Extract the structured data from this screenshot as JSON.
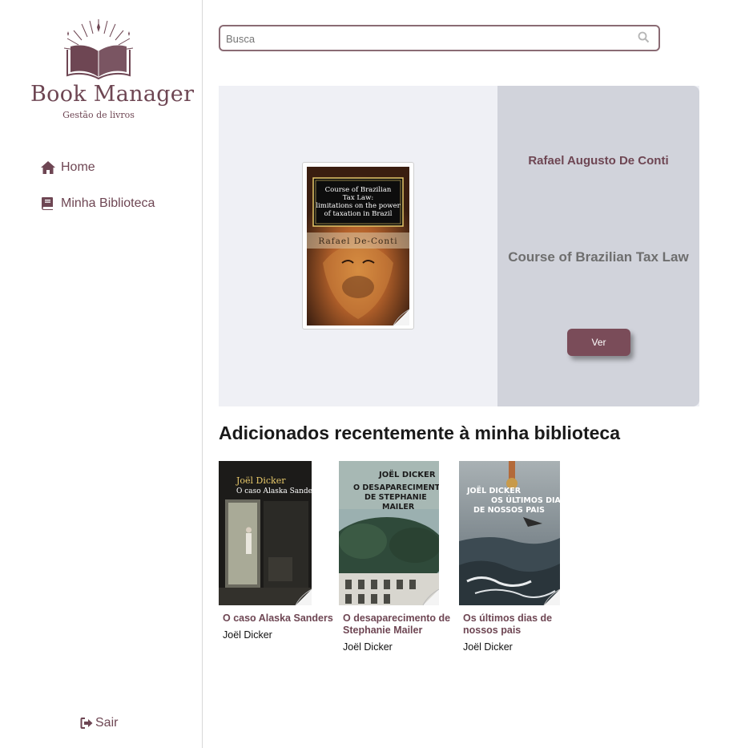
{
  "brand": {
    "name": "Book Manager",
    "tagline": "Gestão de livros",
    "color": "#6e4653"
  },
  "nav": {
    "items": [
      {
        "label": "Home",
        "icon": "home-icon"
      },
      {
        "label": "Minha Biblioteca",
        "icon": "book-icon"
      }
    ],
    "logout_label": "Sair",
    "logout_icon": "sign-out-icon"
  },
  "search": {
    "placeholder": "Busca",
    "value": "",
    "icon": "search-icon"
  },
  "featured": {
    "author": "Rafael Augusto De Conti",
    "title": "Course of Brazilian Tax Law",
    "button_label": "Ver",
    "cover": {
      "title_lines": [
        "Course of Brazilian",
        "Tax Law:",
        "limitations on the power",
        "of taxation in Brazil"
      ],
      "author": "Rafael De-Conti"
    }
  },
  "recent": {
    "heading": "Adicionados recentemente à minha biblioteca",
    "books": [
      {
        "title": "O caso Alaska Sanders",
        "author": "Joël Dicker",
        "cover_author": "Joël Dicker",
        "cover_title": "O caso Alaska Sanders"
      },
      {
        "title": "O desaparecimento de Stephanie Mailer",
        "author": "Joël Dicker",
        "cover_author": "JOËL DICKER",
        "cover_title_lines": [
          "O DESAPARECIMENTO",
          "DE STEPHANIE",
          "MAILER"
        ]
      },
      {
        "title": "Os últimos dias de nossos pais",
        "author": "Joël Dicker",
        "cover_author": "JOËL DICKER",
        "cover_title_lines": [
          "OS ÚLTIMOS DIAS",
          "DE NOSSOS PAIS"
        ]
      }
    ]
  },
  "colors": {
    "accent": "#7a4c59",
    "featured_bg": "#eff0f5",
    "featured_panel": "#d1d3db"
  }
}
